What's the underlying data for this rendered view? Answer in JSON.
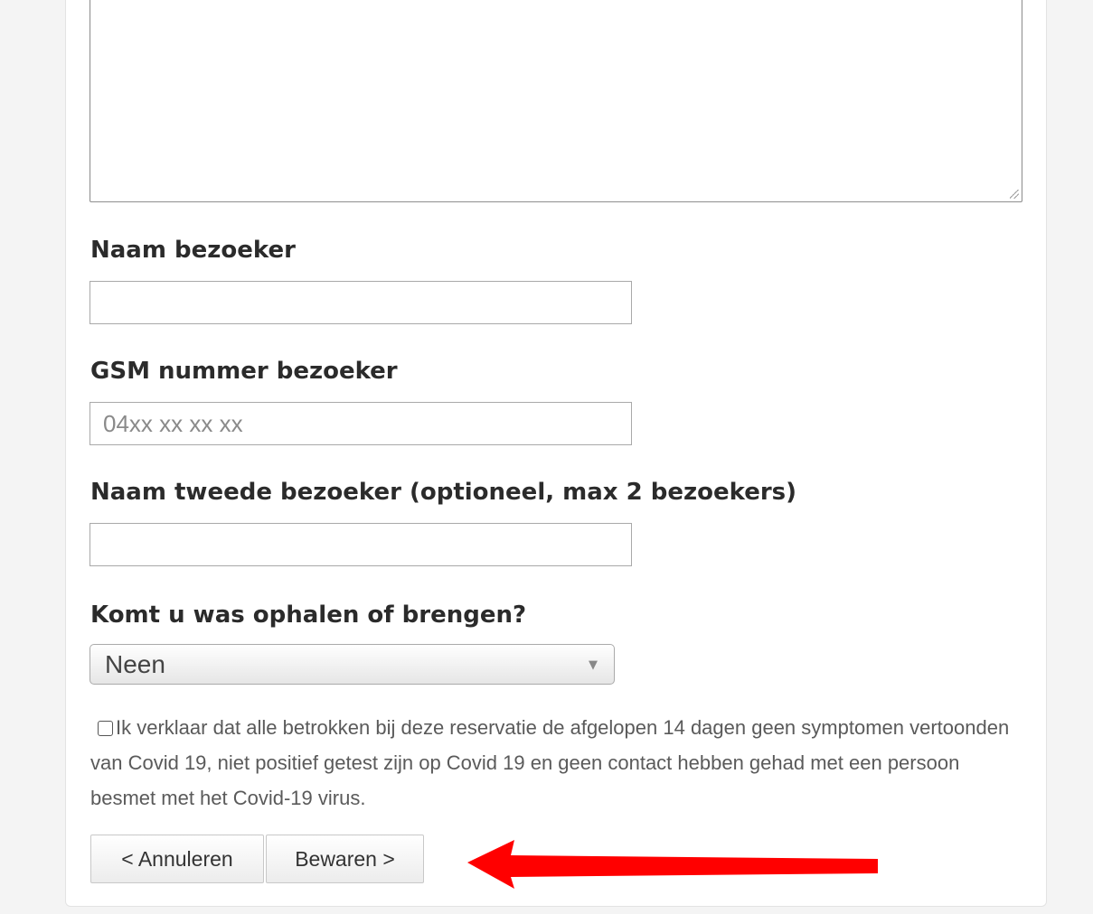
{
  "form": {
    "visitor_name_label": "Naam bezoeker",
    "visitor_name_value": "",
    "phone_label": "GSM nummer bezoeker",
    "phone_placeholder": "04xx xx xx xx",
    "second_visitor_label": "Naam tweede bezoeker (optioneel, max 2 bezoekers)",
    "second_visitor_value": "",
    "laundry_label": "Komt u was ophalen of brengen?",
    "laundry_selected": "Neen",
    "consent_text": "Ik verklaar dat alle betrokken bij deze reservatie de afgelopen 14 dagen geen symptomen vertoonden van Covid 19, niet positief getest zijn op Covid 19 en geen contact hebben gehad met een persoon besmet met het Covid-19 virus.",
    "consent_checked": false
  },
  "buttons": {
    "cancel_label": "< Annuleren",
    "save_label": "Bewaren >"
  },
  "annotation": {
    "arrow_color": "#ff0000",
    "arrow_icon": "left-arrow-icon"
  }
}
